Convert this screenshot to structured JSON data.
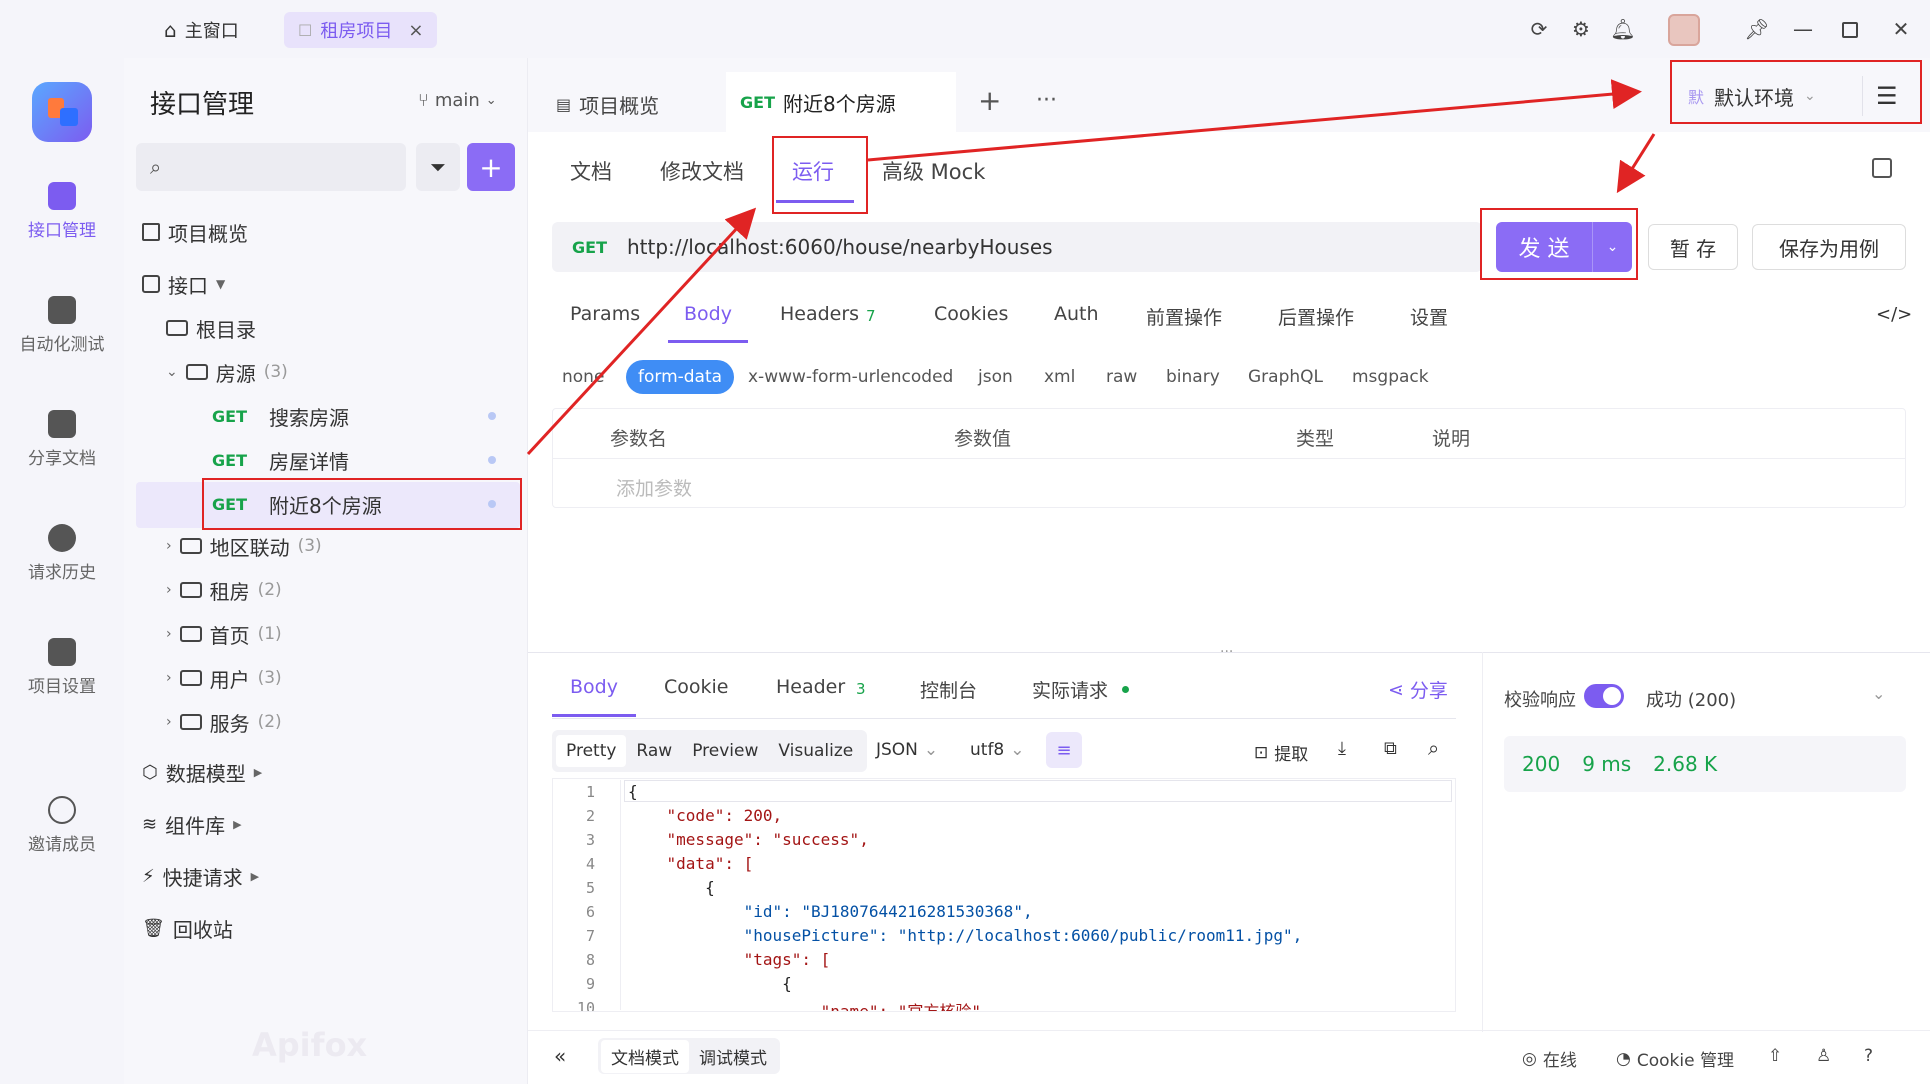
{
  "titlebar": {
    "home_tab": "主窗口",
    "project_tab": "租房项目",
    "close": "×"
  },
  "rail": {
    "items": [
      "接口管理",
      "自动化测试",
      "分享文档",
      "请求历史",
      "项目设置",
      "邀请成员"
    ]
  },
  "sidebar": {
    "title": "接口管理",
    "branch": "main",
    "search_placeholder": "",
    "project_overview": "项目概览",
    "api_label": "接口",
    "root_dir": "根目录",
    "folders": [
      {
        "name": "房源",
        "count": "(3)"
      },
      {
        "name": "地区联动",
        "count": "(3)"
      },
      {
        "name": "租房",
        "count": "(2)"
      },
      {
        "name": "首页",
        "count": "(1)"
      },
      {
        "name": "用户",
        "count": "(3)"
      },
      {
        "name": "服务",
        "count": "(2)"
      }
    ],
    "endpoints": [
      {
        "method": "GET",
        "name": "搜索房源"
      },
      {
        "method": "GET",
        "name": "房屋详情"
      },
      {
        "method": "GET",
        "name": "附近8个房源"
      }
    ],
    "sections": [
      "数据模型",
      "组件库",
      "快捷请求",
      "回收站"
    ],
    "watermark": "Apifox"
  },
  "main": {
    "tabs": {
      "overview": "项目概览",
      "active_method": "GET",
      "active_name": "附近8个房源",
      "plus": "+",
      "more": "···"
    },
    "env": {
      "badge": "默",
      "name": "默认环境"
    },
    "subtabs": [
      "文档",
      "修改文档",
      "运行",
      "高级 Mock"
    ],
    "request": {
      "method": "GET",
      "url": "http://localhost:6060/house/nearbyHouses",
      "send": "发 送",
      "save": "暂 存",
      "save_case": "保存为用例"
    },
    "param_tabs": [
      "Params",
      "Body",
      "Headers",
      "Cookies",
      "Auth",
      "前置操作",
      "后置操作",
      "设置"
    ],
    "headers_count": "7",
    "body_types": [
      "none",
      "form-data",
      "x-www-form-urlencoded",
      "json",
      "xml",
      "raw",
      "binary",
      "GraphQL",
      "msgpack"
    ],
    "table_headers": [
      "参数名",
      "参数值",
      "类型",
      "说明"
    ],
    "add_param": "添加参数"
  },
  "response": {
    "tabs": [
      "Body",
      "Cookie",
      "Header",
      "控制台",
      "实际请求"
    ],
    "header_count": "3",
    "share": "分享",
    "view_modes": [
      "Pretty",
      "Raw",
      "Preview",
      "Visualize"
    ],
    "format": "JSON",
    "encoding": "utf8",
    "extract": "提取",
    "validate_label": "校验响应",
    "status_text": "成功 (200)",
    "status_code": "200",
    "time": "9 ms",
    "size": "2.68 K",
    "code_lines": [
      "{",
      "    \"code\": 200,",
      "    \"message\": \"success\",",
      "    \"data\": [",
      "        {",
      "            \"id\": \"BJ1807644216281530368\",",
      "            \"housePicture\": \"http://localhost:6060/public/room11.jpg\",",
      "            \"tags\": [",
      "                {",
      "                    \"name\": \"官方核验\","
    ],
    "line_numbers": [
      "1",
      "2",
      "3",
      "4",
      "5",
      "6",
      "7",
      "8",
      "9",
      "10"
    ]
  },
  "bottombar": {
    "doc_mode": "文档模式",
    "debug_mode": "调试模式",
    "online": "在线",
    "cookie_mgmt": "Cookie 管理"
  },
  "colors": {
    "accent": "#7c5cf0",
    "get": "#17a34a",
    "annotation": "#e02424"
  }
}
